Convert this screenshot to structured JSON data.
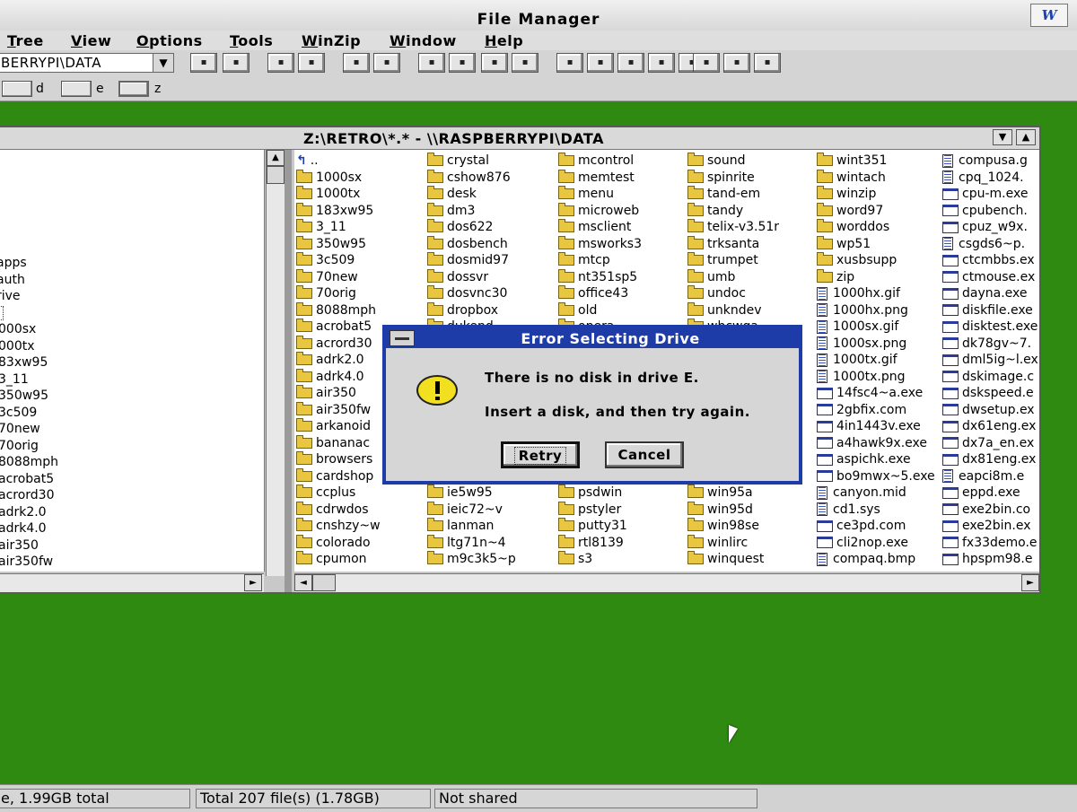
{
  "app": {
    "title": "File Manager",
    "word_icon": "W"
  },
  "menu": [
    "Tree",
    "View",
    "Options",
    "Tools",
    "WinZip",
    "Window",
    "Help"
  ],
  "toolbar": {
    "drive_combo_value": "BERRYPI\\DATA",
    "buttons": [
      "connect-net-drive",
      "disconnect-net-drive",
      "share",
      "stop-sharing",
      "large-icons",
      "small-icons",
      "sort-by-name",
      "sort-by-type",
      "view-all",
      "view-details",
      "search",
      "copy",
      "move",
      "delete",
      "rename",
      "properties",
      "print",
      "exit"
    ]
  },
  "drives": [
    {
      "letter": "d",
      "icon": "hard-drive-icon"
    },
    {
      "letter": "e",
      "icon": "removable-drive-icon"
    },
    {
      "letter": "z",
      "icon": "network-drive-icon"
    }
  ],
  "window": {
    "title": "Z:\\RETRO\\*.* - \\\\RASPBERRYPI\\DATA",
    "minimize_icon": "down-arrow-icon",
    "maximize_icon": "up-arrow-icon"
  },
  "tree": [
    "apps",
    "auth",
    "rive",
    "",
    "000sx",
    "000tx",
    "83xw95",
    "3_11",
    "350w95",
    "3c509",
    "70new",
    "70orig",
    "8088mph",
    "acrobat5",
    "acrord30",
    "adrk2.0",
    "adrk4.0",
    "air350",
    "air350fw"
  ],
  "files": {
    "col1": [
      {
        "name": "..",
        "kind": "up"
      },
      {
        "name": "1000sx",
        "kind": "folder"
      },
      {
        "name": "1000tx",
        "kind": "folder"
      },
      {
        "name": "183xw95",
        "kind": "folder"
      },
      {
        "name": "3_11",
        "kind": "folder"
      },
      {
        "name": "350w95",
        "kind": "folder"
      },
      {
        "name": "3c509",
        "kind": "folder"
      },
      {
        "name": "70new",
        "kind": "folder"
      },
      {
        "name": "70orig",
        "kind": "folder"
      },
      {
        "name": "8088mph",
        "kind": "folder"
      },
      {
        "name": "acrobat5",
        "kind": "folder"
      },
      {
        "name": "acrord30",
        "kind": "folder"
      },
      {
        "name": "adrk2.0",
        "kind": "folder"
      },
      {
        "name": "adrk4.0",
        "kind": "folder"
      },
      {
        "name": "air350",
        "kind": "folder"
      },
      {
        "name": "air350fw",
        "kind": "folder"
      },
      {
        "name": "arkanoid",
        "kind": "folder"
      },
      {
        "name": "bananac",
        "kind": "folder"
      },
      {
        "name": "browsers",
        "kind": "folder"
      },
      {
        "name": "cardshop",
        "kind": "folder"
      },
      {
        "name": "ccplus",
        "kind": "folder"
      },
      {
        "name": "cdrwdos",
        "kind": "folder"
      },
      {
        "name": "cnshzy~w",
        "kind": "folder"
      },
      {
        "name": "colorado",
        "kind": "folder"
      },
      {
        "name": "cpumon",
        "kind": "folder"
      }
    ],
    "col2": [
      {
        "name": "crystal",
        "kind": "folder"
      },
      {
        "name": "cshow876",
        "kind": "folder"
      },
      {
        "name": "desk",
        "kind": "folder"
      },
      {
        "name": "dm3",
        "kind": "folder"
      },
      {
        "name": "dos622",
        "kind": "folder"
      },
      {
        "name": "dosbench",
        "kind": "folder"
      },
      {
        "name": "dosmid97",
        "kind": "folder"
      },
      {
        "name": "dossvr",
        "kind": "folder"
      },
      {
        "name": "dosvnc30",
        "kind": "folder"
      },
      {
        "name": "dropbox",
        "kind": "folder"
      },
      {
        "name": "dukend",
        "kind": "folder"
      },
      {
        "name": "",
        "kind": "hidden"
      },
      {
        "name": "",
        "kind": "hidden"
      },
      {
        "name": "",
        "kind": "hidden"
      },
      {
        "name": "",
        "kind": "hidden"
      },
      {
        "name": "",
        "kind": "hidden"
      },
      {
        "name": "",
        "kind": "hidden"
      },
      {
        "name": "",
        "kind": "hidden"
      },
      {
        "name": "",
        "kind": "hidden"
      },
      {
        "name": "",
        "kind": "hidden"
      },
      {
        "name": "ie5w95",
        "kind": "folder"
      },
      {
        "name": "ieic72~v",
        "kind": "folder"
      },
      {
        "name": "lanman",
        "kind": "folder"
      },
      {
        "name": "ltg71n~4",
        "kind": "folder"
      },
      {
        "name": "m9c3k5~p",
        "kind": "folder"
      }
    ],
    "col3": [
      {
        "name": "mcontrol",
        "kind": "folder"
      },
      {
        "name": "memtest",
        "kind": "folder"
      },
      {
        "name": "menu",
        "kind": "folder"
      },
      {
        "name": "microweb",
        "kind": "folder"
      },
      {
        "name": "msclient",
        "kind": "folder"
      },
      {
        "name": "msworks3",
        "kind": "folder"
      },
      {
        "name": "mtcp",
        "kind": "folder"
      },
      {
        "name": "nt351sp5",
        "kind": "folder"
      },
      {
        "name": "office43",
        "kind": "folder"
      },
      {
        "name": "old",
        "kind": "folder"
      },
      {
        "name": "opera",
        "kind": "folder"
      },
      {
        "name": "",
        "kind": "hidden"
      },
      {
        "name": "",
        "kind": "hidden"
      },
      {
        "name": "",
        "kind": "hidden"
      },
      {
        "name": "",
        "kind": "hidden"
      },
      {
        "name": "",
        "kind": "hidden"
      },
      {
        "name": "",
        "kind": "hidden"
      },
      {
        "name": "",
        "kind": "hidden"
      },
      {
        "name": "",
        "kind": "hidden"
      },
      {
        "name": "",
        "kind": "hidden"
      },
      {
        "name": "psdwin",
        "kind": "folder"
      },
      {
        "name": "pstyler",
        "kind": "folder"
      },
      {
        "name": "putty31",
        "kind": "folder"
      },
      {
        "name": "rtl8139",
        "kind": "folder"
      },
      {
        "name": "s3",
        "kind": "folder"
      }
    ],
    "col4": [
      {
        "name": "sound",
        "kind": "folder"
      },
      {
        "name": "spinrite",
        "kind": "folder"
      },
      {
        "name": "tand-em",
        "kind": "folder"
      },
      {
        "name": "tandy",
        "kind": "folder"
      },
      {
        "name": "telix-v3.51r",
        "kind": "folder"
      },
      {
        "name": "trksanta",
        "kind": "folder"
      },
      {
        "name": "trumpet",
        "kind": "folder"
      },
      {
        "name": "umb",
        "kind": "folder"
      },
      {
        "name": "undoc",
        "kind": "folder"
      },
      {
        "name": "unkndev",
        "kind": "folder"
      },
      {
        "name": "wbcwga",
        "kind": "folder"
      },
      {
        "name": "",
        "kind": "hidden"
      },
      {
        "name": "",
        "kind": "hidden"
      },
      {
        "name": "",
        "kind": "hidden"
      },
      {
        "name": "",
        "kind": "hidden"
      },
      {
        "name": "",
        "kind": "hidden"
      },
      {
        "name": "",
        "kind": "hidden"
      },
      {
        "name": "",
        "kind": "hidden"
      },
      {
        "name": "",
        "kind": "hidden"
      },
      {
        "name": "",
        "kind": "hidden"
      },
      {
        "name": "win95a",
        "kind": "folder"
      },
      {
        "name": "win95d",
        "kind": "folder"
      },
      {
        "name": "win98se",
        "kind": "folder"
      },
      {
        "name": "winlirc",
        "kind": "folder"
      },
      {
        "name": "winquest",
        "kind": "folder"
      }
    ],
    "col5": [
      {
        "name": "wint351",
        "kind": "folder"
      },
      {
        "name": "wintach",
        "kind": "folder"
      },
      {
        "name": "winzip",
        "kind": "folder"
      },
      {
        "name": "word97",
        "kind": "folder"
      },
      {
        "name": "worddos",
        "kind": "folder"
      },
      {
        "name": "wp51",
        "kind": "folder"
      },
      {
        "name": "xusbsupp",
        "kind": "folder"
      },
      {
        "name": "zip",
        "kind": "folder"
      },
      {
        "name": "1000hx.gif",
        "kind": "doc"
      },
      {
        "name": "1000hx.png",
        "kind": "doc"
      },
      {
        "name": "1000sx.gif",
        "kind": "doc"
      },
      {
        "name": "1000sx.png",
        "kind": "doc"
      },
      {
        "name": "1000tx.gif",
        "kind": "doc"
      },
      {
        "name": "1000tx.png",
        "kind": "doc"
      },
      {
        "name": "14fsc4~a.exe",
        "kind": "exe"
      },
      {
        "name": "2gbfix.com",
        "kind": "exe"
      },
      {
        "name": "4in1443v.exe",
        "kind": "exe"
      },
      {
        "name": "a4hawk9x.exe",
        "kind": "exe"
      },
      {
        "name": "aspichk.exe",
        "kind": "exe"
      },
      {
        "name": "bo9mwx~5.exe",
        "kind": "exe"
      },
      {
        "name": "canyon.mid",
        "kind": "doc"
      },
      {
        "name": "cd1.sys",
        "kind": "doc"
      },
      {
        "name": "ce3pd.com",
        "kind": "exe"
      },
      {
        "name": "cli2nop.exe",
        "kind": "exe"
      },
      {
        "name": "compaq.bmp",
        "kind": "doc"
      }
    ],
    "col6": [
      {
        "name": "compusa.g",
        "kind": "doc"
      },
      {
        "name": "cpq_1024.",
        "kind": "doc"
      },
      {
        "name": "cpu-m.exe",
        "kind": "exe"
      },
      {
        "name": "cpubench.",
        "kind": "exe"
      },
      {
        "name": "cpuz_w9x.",
        "kind": "exe"
      },
      {
        "name": "csgds6~p.",
        "kind": "doc"
      },
      {
        "name": "ctcmbbs.ex",
        "kind": "exe"
      },
      {
        "name": "ctmouse.ex",
        "kind": "exe"
      },
      {
        "name": "dayna.exe",
        "kind": "exe"
      },
      {
        "name": "diskfile.exe",
        "kind": "exe"
      },
      {
        "name": "disktest.exe",
        "kind": "exe"
      },
      {
        "name": "dk78gv~7.",
        "kind": "exe"
      },
      {
        "name": "dml5ig~l.ex",
        "kind": "exe"
      },
      {
        "name": "dskimage.c",
        "kind": "exe"
      },
      {
        "name": "dskspeed.e",
        "kind": "exe"
      },
      {
        "name": "dwsetup.ex",
        "kind": "exe"
      },
      {
        "name": "dx61eng.ex",
        "kind": "exe"
      },
      {
        "name": "dx7a_en.ex",
        "kind": "exe"
      },
      {
        "name": "dx81eng.ex",
        "kind": "exe"
      },
      {
        "name": "eapci8m.e",
        "kind": "doc"
      },
      {
        "name": "eppd.exe",
        "kind": "exe"
      },
      {
        "name": "exe2bin.co",
        "kind": "exe"
      },
      {
        "name": "exe2bin.ex",
        "kind": "exe"
      },
      {
        "name": "fx33demo.e",
        "kind": "exe"
      },
      {
        "name": "hpspm98.e",
        "kind": "exe"
      }
    ]
  },
  "dialog": {
    "title": "Error Selecting Drive",
    "icon": "warning-icon",
    "line1": "There is no disk in drive E.",
    "line2": "Insert a disk, and then try again.",
    "retry_label": "Retry",
    "cancel_label": "Cancel"
  },
  "status": {
    "disk": "e, 1.99GB total",
    "total": "Total 207 file(s) (1.78GB)",
    "share": "Not shared"
  },
  "colors": {
    "desktop": "#2f8a12",
    "dialog_title": "#1e3ca8",
    "folder": "#e8c640"
  }
}
